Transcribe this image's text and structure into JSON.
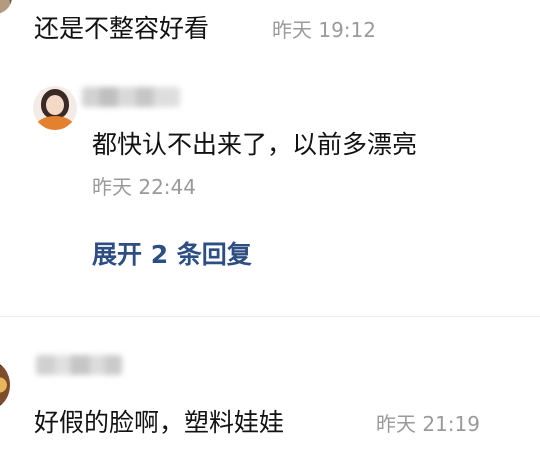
{
  "comments": [
    {
      "text": "还是不整容好看",
      "time": "昨天 19:12"
    },
    {
      "text": "好假的脸啊，塑料娃娃",
      "time": "昨天 21:19"
    }
  ],
  "reply": {
    "text": "都快认不出来了，以前多漂亮",
    "time": "昨天 22:44"
  },
  "expand_replies_label": "展开 2 条回复",
  "colors": {
    "link": "#2c4e82",
    "timestamp": "#9a9a9a",
    "text": "#121212",
    "divider": "#ececec"
  }
}
